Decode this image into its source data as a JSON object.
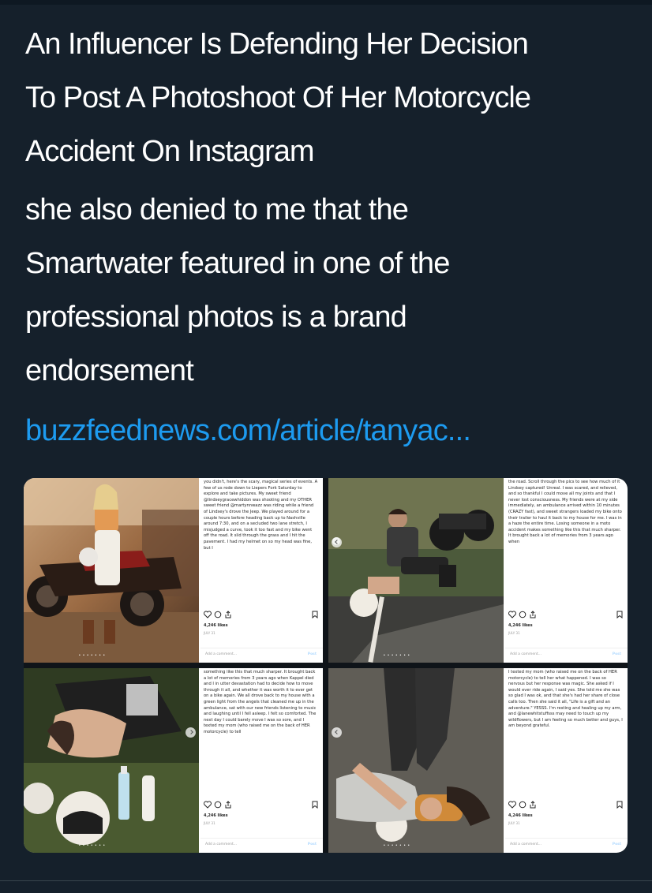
{
  "tweet": {
    "headline_lines": [
      "An Influencer Is Defending Her Decision",
      "To Post A Photoshoot Of Her Motorcycle",
      "Accident On Instagram"
    ],
    "body_lines": [
      "she also denied to me that the",
      "Smartwater featured in one of the",
      "professional photos is a brand",
      "endorsement"
    ],
    "link_text": "buzzfeednews.com/article/tanyac..."
  },
  "posts": [
    {
      "caption": "you didn't, here's the scary, magical series of events. A few of us rode down to Liepers Fork Saturday to explore and take pictures. My sweet friend @lindseygracewhiddon was shooting and my OTHER sweet friend @martynnwazz was riding while a friend of Lindsey's drove the Jeep. We played around for a couple hours before heading back up to Nashville around 7:30, and on a secluded two lane stretch, I misjudged a curve, took it too fast and my bike went off the road. It slid through the grass and I hit the pavement. I had my helmet on so my head was fine, but I",
      "likes": "4,246 likes",
      "date": "JULY 31",
      "add_comment": "Add a comment...",
      "post_label": "Post"
    },
    {
      "caption": "the road. Scroll through the pics to see how much of it Lindsey captured! Unreal. I was scared, and relieved, and so thankful I could move all my joints and that I never lost consciousness. My friends were at my side immediately, an ambulance arrived within 10 minutes (CRAZY fast), and sweet strangers loaded my bike onto their trailer to haul it back to my house for me. I was in a haze the entire time. Losing someone in a moto accident makes something like this that much sharper. It brought back a lot of memories from 3 years ago when",
      "likes": "4,246 likes",
      "date": "JULY 31",
      "add_comment": "Add a comment...",
      "post_label": "Post"
    },
    {
      "caption": "something like this that much sharper. It brought back a lot of memories from 3 years ago when Kappel died and I in utter devastation had to decide how to move through it all, and whether it was worth it to ever get on a bike again. We all drove back to my house with a green light from the angels that cleaned me up in the ambulance, sat with our new friends listening to music and laughing until I fell asleep. I felt so comforted. The next day I could barely move I was so sore, and I texted my mom (who raised me on the back of HER motorcycle) to tell",
      "likes": "4,246 likes",
      "date": "JULY 31",
      "add_comment": "Add a comment...",
      "post_label": "Post"
    },
    {
      "caption": "I texted my mom (who raised me on the back of HER motorcycle) to tell her what happened. I was so nervous but her response was magic. She asked if I would ever ride again, I said yes. She told me she was so glad I was ok, and that she's had her share of close calls too. Then she said it all, \"Life is a gift and an adventure.\" YESSS. I'm resting and healing up my arm, and @lanewhitstuffsss may need to touch up my wildflowers, but I am feeling so much better and guys, I am beyond grateful.",
      "likes": "4,246 likes",
      "date": "JULY 31",
      "add_comment": "Add a comment...",
      "post_label": "Post"
    }
  ]
}
